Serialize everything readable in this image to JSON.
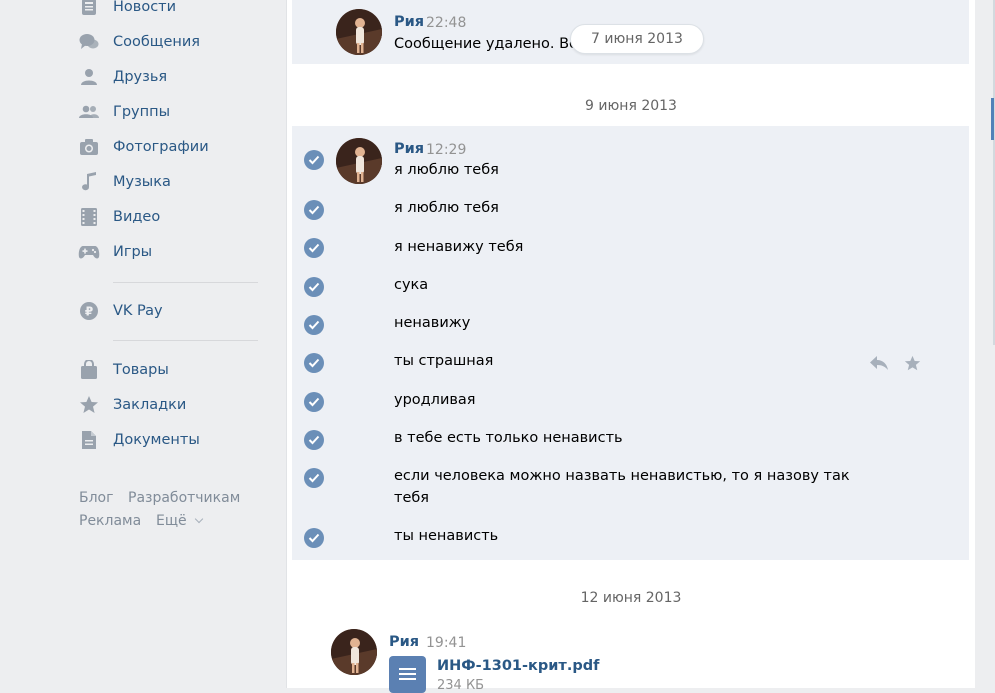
{
  "sidebar": {
    "items": [
      {
        "label": "Новости",
        "icon": "news-icon"
      },
      {
        "label": "Сообщения",
        "icon": "messages-icon"
      },
      {
        "label": "Друзья",
        "icon": "friends-icon"
      },
      {
        "label": "Группы",
        "icon": "groups-icon"
      },
      {
        "label": "Фотографии",
        "icon": "camera-icon"
      },
      {
        "label": "Музыка",
        "icon": "music-note-icon"
      },
      {
        "label": "Видео",
        "icon": "video-film-icon"
      },
      {
        "label": "Игры",
        "icon": "gamepad-icon"
      },
      {
        "label": "VK Pay",
        "icon": "ruble-coin-icon"
      },
      {
        "label": "Товары",
        "icon": "shopping-bag-icon"
      },
      {
        "label": "Закладки",
        "icon": "star-icon"
      },
      {
        "label": "Документы",
        "icon": "document-icon"
      }
    ],
    "footer": {
      "blog": "Блог",
      "developers": "Разработчикам",
      "ads": "Реклама",
      "more": "Ещё"
    }
  },
  "chat": {
    "sender": "Рия",
    "floating_date": "7 июня 2013",
    "first": {
      "time": "22:48",
      "text": "Сообщение удалено. Во"
    },
    "group2": {
      "date": "9 июня 2013",
      "time": "12:29",
      "messages": [
        "я люблю тебя",
        "я люблю тебя",
        "я ненавижу тебя",
        "сука",
        "ненавижу",
        "ты страшная",
        "уродливая",
        "в тебе есть только ненависть",
        "если человека можно назвать ненавистью, то я назову так тебя",
        "ты ненависть"
      ]
    },
    "group3": {
      "date": "12 июня 2013",
      "time": "19:41",
      "file_name": "ИНФ-1301-крит.pdf",
      "file_size": "234 КБ"
    }
  },
  "colors": {
    "link": "#2a5885",
    "selection_bg": "#edf0f5",
    "check": "#6b8fb8",
    "page_bg": "#edeef0"
  }
}
